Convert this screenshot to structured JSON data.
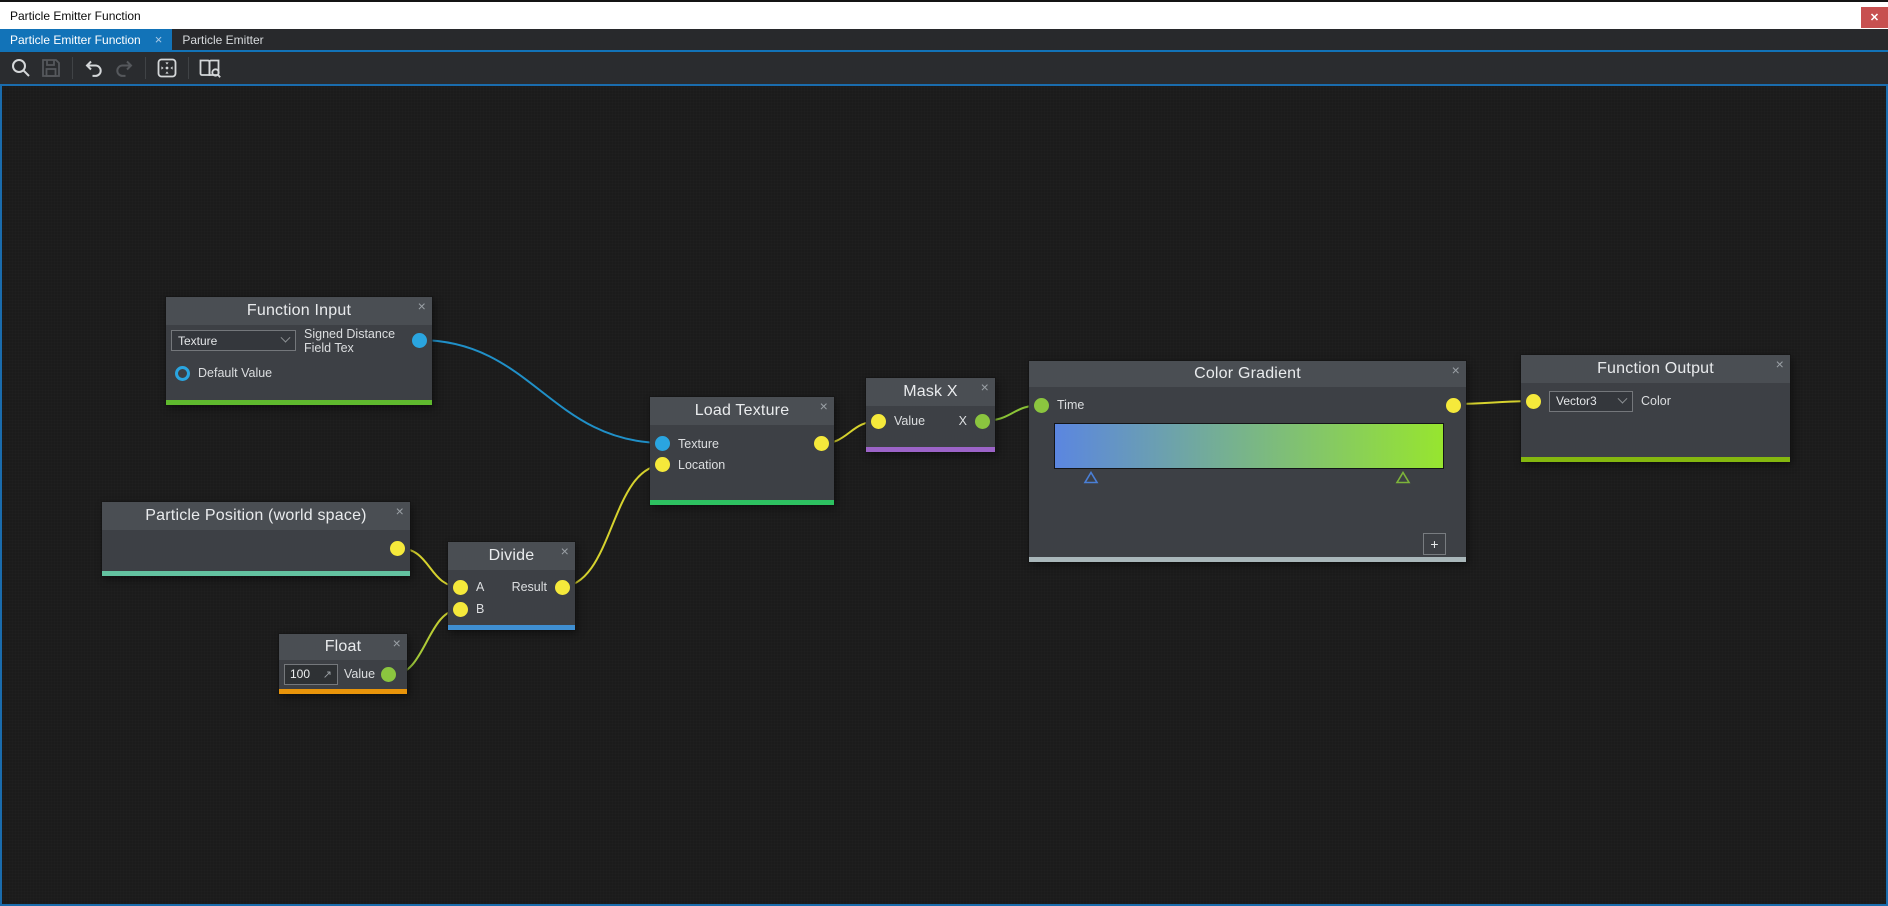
{
  "window": {
    "title": "Particle Emitter Function",
    "close_glyph": "✕"
  },
  "tabs": {
    "active": {
      "label": "Particle Emitter Function",
      "close_glyph": "×"
    },
    "other": {
      "label": "Particle Emitter"
    }
  },
  "toolbar": {
    "icons": [
      {
        "name": "zoom-search",
        "enabled": true
      },
      {
        "name": "save",
        "enabled": false
      },
      {
        "name": "undo",
        "enabled": true
      },
      {
        "name": "redo",
        "enabled": false
      },
      {
        "name": "fit-view",
        "enabled": true
      },
      {
        "name": "node-library",
        "enabled": true
      }
    ]
  },
  "accents": {
    "tab_active": "#1273b8",
    "canvas_border": "#1a6cad",
    "titlebar_close_bg": "#c75050",
    "port_yellow": "#f5e93b",
    "port_blue": "#2aa5e0",
    "port_green": "#8bc53f",
    "wire_yellow": "#d6d22e",
    "wire_texture": "#2090c8",
    "wire_green": "#8bc437",
    "node_header": "#4a4e53",
    "node_body": "#3d4045"
  },
  "nodes": {
    "function_input": {
      "title": "Function Input",
      "close_glyph": "×",
      "type_dropdown_value": "Texture",
      "output_label": "Signed Distance Field Tex",
      "default_value_label": "Default Value",
      "strip": "#5fb92e"
    },
    "particle_position": {
      "title": "Particle Position (world space)",
      "close_glyph": "×",
      "strip": "#63c2a0"
    },
    "divide": {
      "title": "Divide",
      "close_glyph": "×",
      "input_a_label": "A",
      "input_b_label": "B",
      "output_label": "Result",
      "strip": "#3f8fd2"
    },
    "float": {
      "title": "Float",
      "close_glyph": "×",
      "value": "100",
      "expand_icon_glyph": "↗",
      "value_label": "Value",
      "strip": "#e8940a"
    },
    "load_texture": {
      "title": "Load Texture",
      "close_glyph": "×",
      "input_texture_label": "Texture",
      "input_location_label": "Location",
      "strip": "#2dc060"
    },
    "mask_x": {
      "title": "Mask X",
      "close_glyph": "×",
      "input_label": "Value",
      "output_label": "X",
      "strip": "#9c64c8"
    },
    "color_gradient": {
      "title": "Color Gradient",
      "close_glyph": "×",
      "input_label": "Time",
      "add_button_label": "+",
      "strip": "#a9b7ba",
      "gradient": {
        "start": "#5b86e0",
        "end": "#97e52f",
        "marker_left_color": "#4a7fd6",
        "marker_right_color": "#7db33a",
        "marker_left_pos_pct": 9,
        "marker_right_pos_pct": 89
      }
    },
    "function_output": {
      "title": "Function Output",
      "close_glyph": "×",
      "type_dropdown_value": "Vector3",
      "input_label": "Color",
      "strip": "#84b70f"
    }
  }
}
